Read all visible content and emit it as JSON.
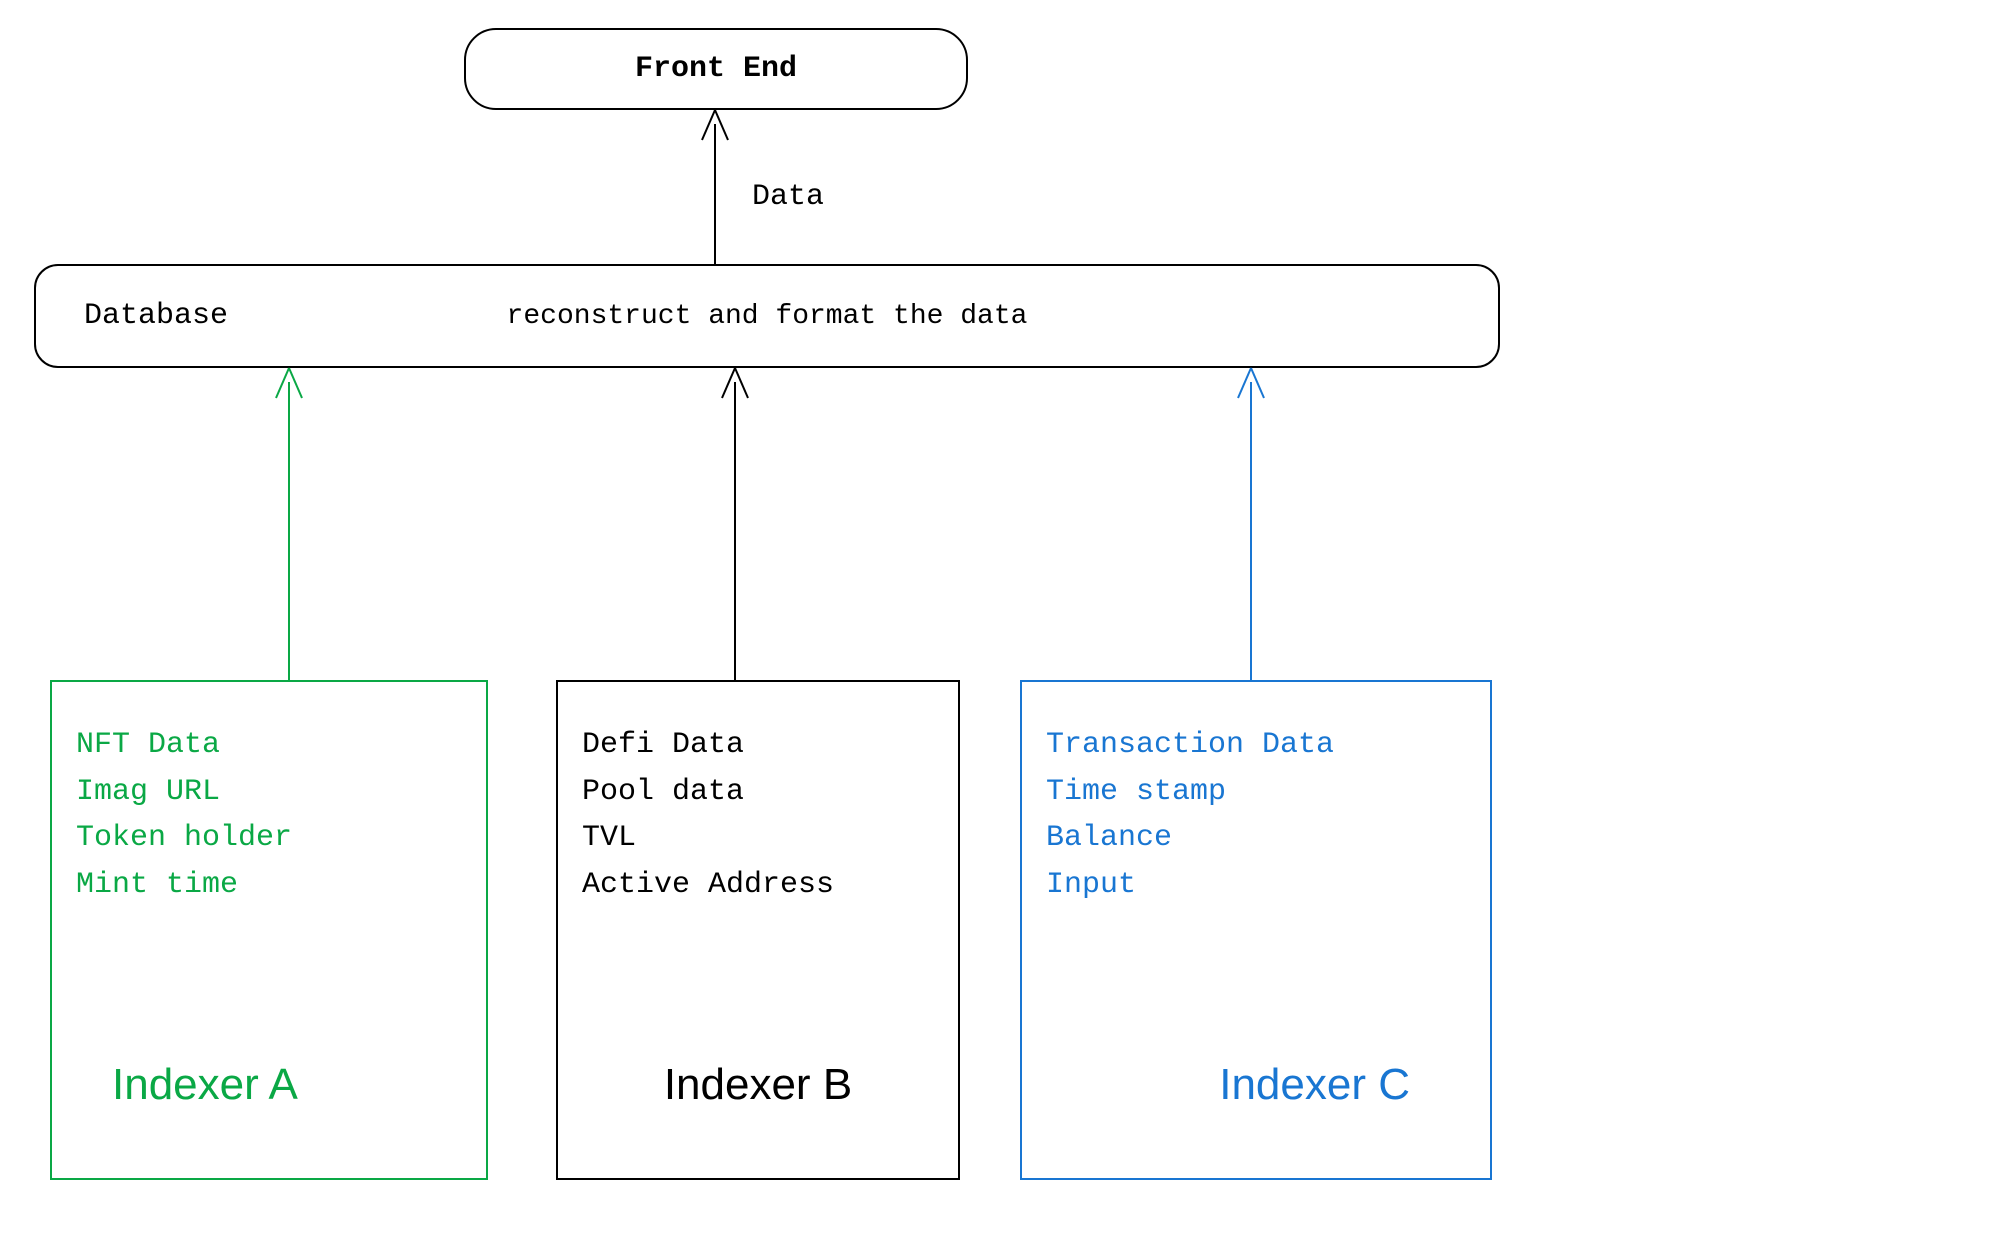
{
  "frontEnd": {
    "label": "Front End"
  },
  "dataArrow": {
    "label": "Data"
  },
  "database": {
    "leftLabel": "Database",
    "centerLabel": "reconstruct and format the data"
  },
  "indexers": {
    "a": {
      "title": "Indexer A",
      "items": [
        "NFT Data",
        "Imag URL",
        "Token holder",
        "Mint time"
      ],
      "color": "#0aa845"
    },
    "b": {
      "title": "Indexer B",
      "items": [
        "Defi Data",
        "Pool data",
        "TVL",
        "Active Address"
      ],
      "color": "#000000"
    },
    "c": {
      "title": "Indexer C",
      "items": [
        "Transaction Data",
        "Time stamp",
        "Balance",
        "Input"
      ],
      "color": "#1976d2"
    }
  }
}
